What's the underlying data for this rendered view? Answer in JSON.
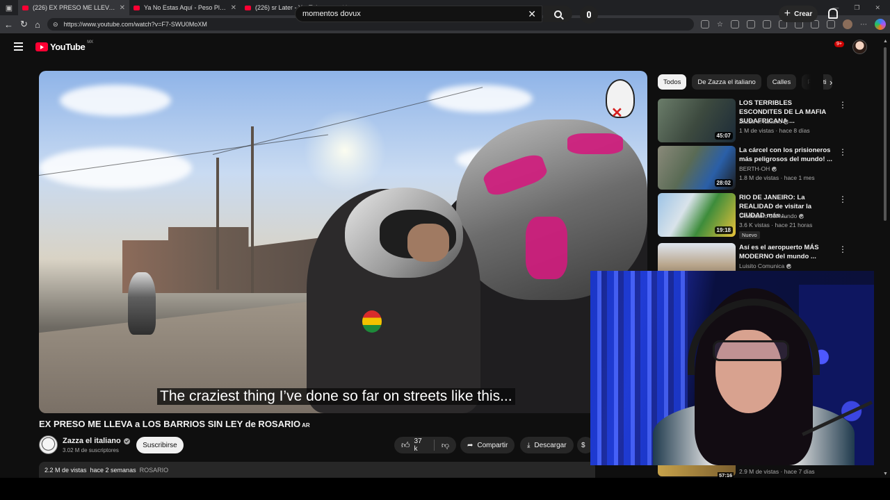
{
  "browser": {
    "tabs": [
      {
        "label": "(226) EX PRESO ME LLEVA a LOS",
        "active": true
      },
      {
        "label": "Ya No Estas Aquí - Peso Pluma, F",
        "active": false
      },
      {
        "label": "(226) sr Later - YouTube",
        "active": false
      }
    ],
    "url": "https://www.youtube.com/watch?v=F7-SWU0MoXM"
  },
  "youtube": {
    "logo_text": "YouTube",
    "country_code": "MX",
    "search_value": "momentos dovux",
    "create_label": "Crear",
    "notifications_badge": "9+"
  },
  "video": {
    "subtitle": "The craziest thing I’ve done so far on streets like this...",
    "title": "EX PRESO ME LLEVA a LOS BARRIOS SIN LEY de ROSARIO",
    "title_suffix": "AR",
    "channel_name": "Zazza el italiano",
    "subscribers": "3.02 M de suscriptores",
    "subscribe_label": "Suscribirse",
    "likes": "37 k",
    "share_label": "Compartir",
    "download_label": "Descargar",
    "views": "2.2 M de vistas",
    "posted": "hace 2 semanas",
    "tag": "ROSARIO"
  },
  "sidebar": {
    "chips": [
      "Todos",
      "De Zazza el italiano",
      "Calles",
      "Para ti"
    ],
    "recommendations": [
      {
        "title": "LOS TERRIBLES ESCONDITES DE LA MAFIA SUDAFRICANA ...",
        "channel": "Zazza el italiano",
        "meta": "1 M de vistas · hace 8 días",
        "duration": "45:07",
        "is_new": false
      },
      {
        "title": "La cárcel con los prisioneros más peligrosos del mundo! ...",
        "channel": "BERTH-OH",
        "meta": "1.8 M de vistas · hace 1 mes",
        "duration": "28:02",
        "is_new": false
      },
      {
        "title": "RIO DE JANEIRO: La REALIDAD de visitar la CIUDAD más ...",
        "channel": "Ciudadano del Mundo",
        "meta": "3.6 K vistas · hace 21 horas",
        "duration": "19:18",
        "is_new": true,
        "new_label": "Nuevo"
      },
      {
        "title": "Así es el aeropuerto MÁS MODERNO del mundo ...",
        "channel": "Luisito Comunica",
        "meta": "",
        "duration": "",
        "is_new": false
      }
    ],
    "bottom_partial": {
      "meta": "2.9 M de vistas · hace 7 días",
      "duration": "57:16"
    }
  }
}
